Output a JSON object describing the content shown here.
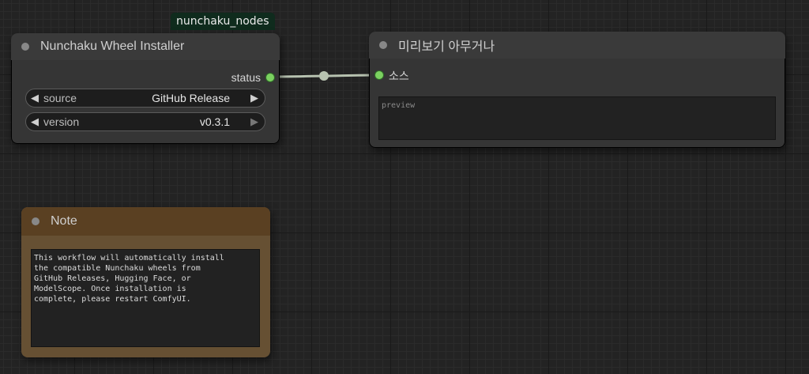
{
  "badge": {
    "text": "nunchaku_nodes"
  },
  "installer_node": {
    "title": "Nunchaku Wheel Installer",
    "output_label": "status",
    "widgets": [
      {
        "label": "source",
        "value": "GitHub Release"
      },
      {
        "label": "version",
        "value": "v0.3.1"
      }
    ]
  },
  "preview_node": {
    "title": "미리보기 아무거나",
    "input_label": "소스",
    "placeholder": "preview"
  },
  "note_node": {
    "title": "Note",
    "text": "This workflow will automatically install\nthe compatible Nunchaku wheels from\nGitHub Releases, Hugging Face, or\nModelScope. Once installation is\ncomplete, please restart ComfyUI."
  },
  "colors": {
    "canvas": "#232323",
    "node_body": "#353535",
    "note_body": "#665033",
    "slot_green": "#7bd160",
    "link": "#b7c2b0",
    "badge_bg": "#0f2b1d"
  }
}
